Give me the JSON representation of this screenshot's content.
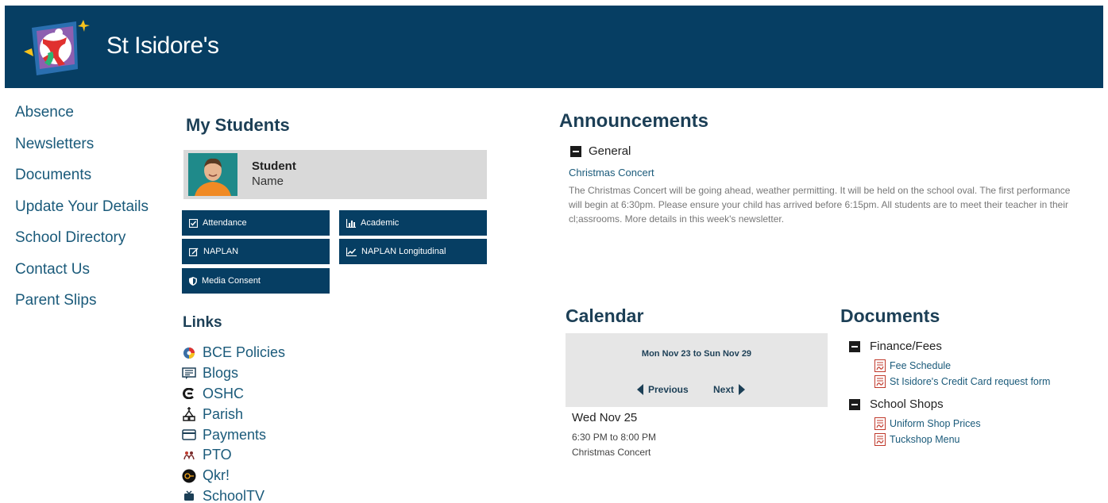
{
  "header": {
    "school_name": "St Isidore's"
  },
  "nav": {
    "items": [
      "Absence",
      "Newsletters",
      "Documents",
      "Update Your Details",
      "School Directory",
      "Contact Us",
      "Parent Slips"
    ]
  },
  "my_students": {
    "title": "My Students",
    "student": {
      "line1": "Student",
      "line2": "Name"
    },
    "tiles": {
      "attendance": "Attendance",
      "academic": "Academic",
      "naplan": "NAPLAN",
      "naplan_longitudinal": "NAPLAN Longitudinal",
      "media_consent": "Media Consent"
    }
  },
  "links": {
    "title": "Links",
    "items": [
      {
        "label": "BCE Policies",
        "icon": "bce-icon"
      },
      {
        "label": "Blogs",
        "icon": "blog-icon"
      },
      {
        "label": "OSHC",
        "icon": "oshc-icon"
      },
      {
        "label": "Parish",
        "icon": "church-icon"
      },
      {
        "label": "Payments",
        "icon": "credit-card-icon"
      },
      {
        "label": "PTO",
        "icon": "pto-icon"
      },
      {
        "label": "Qkr!",
        "icon": "qkr-icon"
      },
      {
        "label": "SchoolTV",
        "icon": "schooltv-icon"
      }
    ]
  },
  "announcements": {
    "title": "Announcements",
    "category": "General",
    "item_title": "Christmas Concert",
    "item_body": "The Christmas Concert will be going ahead, weather permitting.  It will be held on the school oval.  The first performance will begin at 6:30pm.  Please ensure your child has arrived before 6:15pm.  All students are to meet their teacher in their cl;assrooms.  More details in this week's newsletter."
  },
  "calendar": {
    "title": "Calendar",
    "range": "Mon Nov 23 to Sun Nov 29",
    "prev_label": "Previous",
    "next_label": "Next",
    "event": {
      "date": "Wed Nov 25",
      "time": "6:30 PM to 8:00 PM",
      "title": "Christmas Concert"
    }
  },
  "documents": {
    "title": "Documents",
    "groups": [
      {
        "name": "Finance/Fees",
        "items": [
          "Fee Schedule",
          "St Isidore's Credit Card request form"
        ]
      },
      {
        "name": "School Shops",
        "items": [
          "Uniform Shop Prices",
          "Tuckshop Menu"
        ]
      }
    ]
  },
  "colors": {
    "brand_navy": "#063e63",
    "link_blue": "#1a5a7a",
    "heading": "#1c3f56"
  }
}
